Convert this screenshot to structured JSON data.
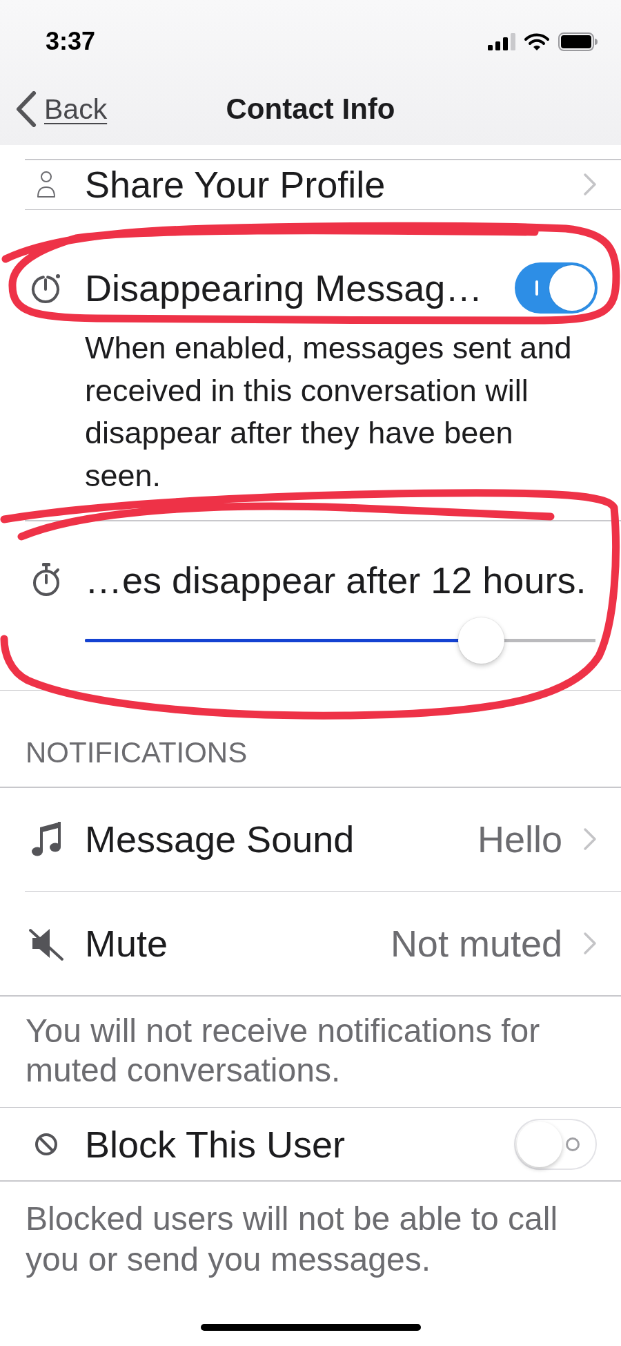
{
  "status_bar": {
    "time": "3:37"
  },
  "nav_bar": {
    "back_label": "Back",
    "title": "Contact Info"
  },
  "share_profile": {
    "label": "Share Your Profile"
  },
  "disappearing_messages": {
    "label": "Disappearing Messag…",
    "on": true,
    "description": "When enabled, messages sent and received in this conversation will disappear after they have been seen."
  },
  "disappear_timer": {
    "label": "…es disappear after 12 hours.",
    "level": 0.776
  },
  "notifications": {
    "header": "NOTIFICATIONS",
    "rows": [
      {
        "label": "Message Sound",
        "value": "Hello"
      },
      {
        "label": "Mute",
        "value": "Not muted"
      }
    ],
    "footer": "You will not receive notifications for muted conversations."
  },
  "block_user": {
    "label": "Block This User",
    "on": false,
    "footer": "Blocked users will not be able to call you or send you messages."
  }
}
